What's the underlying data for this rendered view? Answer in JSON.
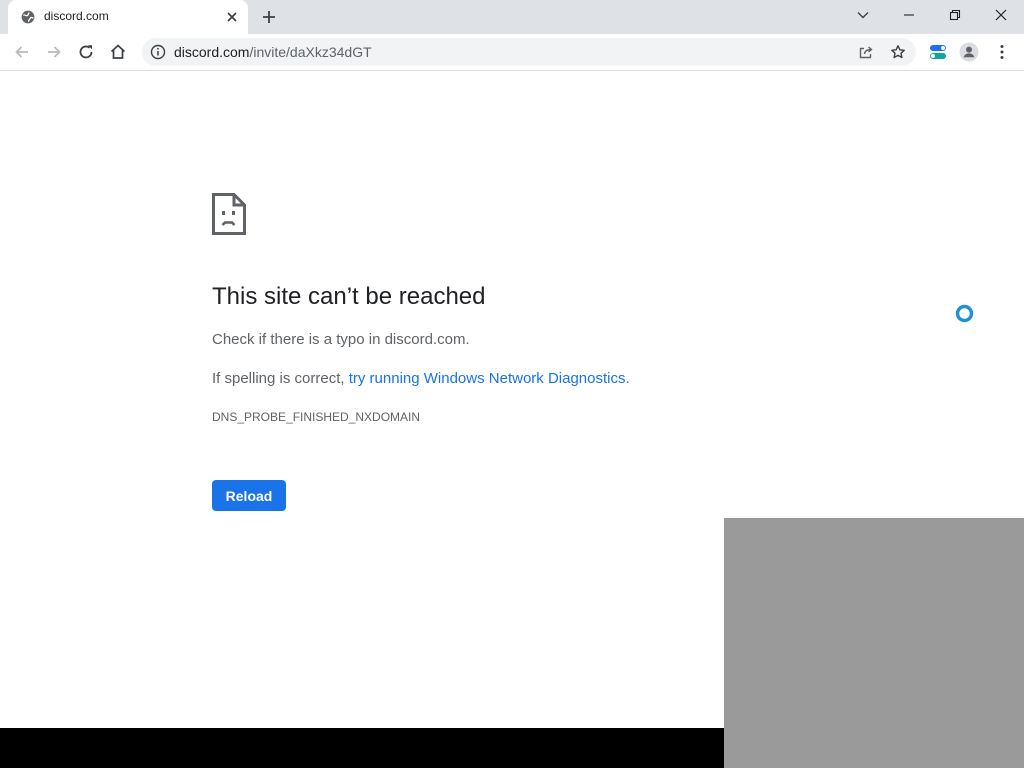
{
  "browser": {
    "tab": {
      "title": "discord.com",
      "favicon": "globe-icon"
    },
    "address": {
      "domain": "discord.com",
      "path": "/invite/daXkz34dGT"
    }
  },
  "error": {
    "title": "This site can’t be reached",
    "typo_line": "Check if there is a typo in discord.com.",
    "diag_prefix": "If spelling is correct, ",
    "diag_link": "try running Windows Network Diagnostics",
    "diag_suffix": ".",
    "code": "DNS_PROBE_FINISHED_NXDOMAIN",
    "reload_label": "Reload"
  },
  "colors": {
    "accent": "#1a73e8",
    "spinner": "#1e90d6"
  }
}
